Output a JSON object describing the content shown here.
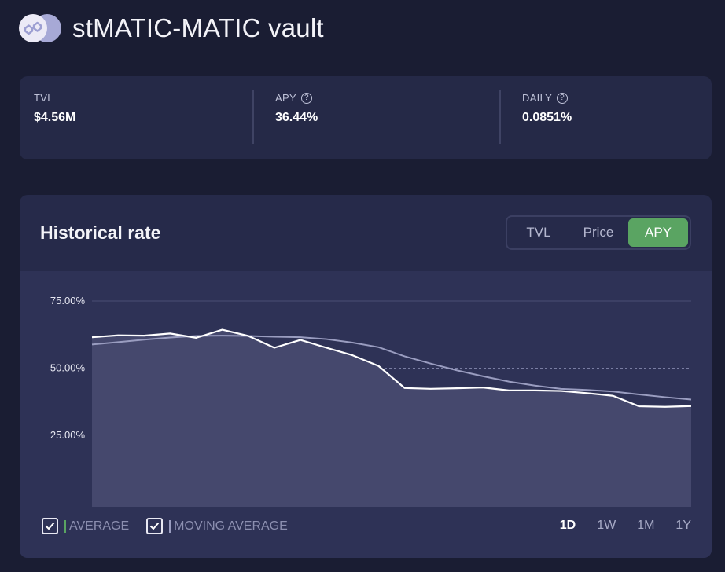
{
  "header": {
    "logo_icon": "polygon-logo-icon",
    "title": "stMATIC-MATIC vault"
  },
  "stats": {
    "tvl": {
      "label": "TVL",
      "value": "$4.56M"
    },
    "apy": {
      "label": "APY",
      "value": "36.44%",
      "help_icon": "question-circle-icon"
    },
    "daily": {
      "label": "DAILY",
      "value": "0.0851%",
      "help_icon": "question-circle-icon"
    }
  },
  "historical": {
    "title": "Historical rate",
    "tabs": [
      {
        "label": "TVL",
        "active": false
      },
      {
        "label": "Price",
        "active": false
      },
      {
        "label": "APY",
        "active": true
      }
    ],
    "legend": {
      "average": "AVERAGE",
      "average_color": "#5aa462",
      "moving_average": "MOVING AVERAGE",
      "moving_average_color": "#9a9dc0"
    },
    "ranges": [
      {
        "label": "1D",
        "active": true
      },
      {
        "label": "1W",
        "active": false
      },
      {
        "label": "1M",
        "active": false
      },
      {
        "label": "1Y",
        "active": false
      }
    ]
  },
  "colors": {
    "accent": "#5aa462",
    "background": "#1a1d33",
    "card": "#262a4a"
  },
  "chart_data": {
    "type": "line",
    "yticks": [
      "75.00%",
      "50.00%",
      "25.00%"
    ],
    "ylim": [
      0,
      75
    ],
    "grid": true,
    "reference_line": 50,
    "series": [
      {
        "name": "APY",
        "values": [
          61.5,
          62.2,
          62.1,
          62.9,
          61.3,
          64.3,
          62.0,
          57.6,
          60.5,
          57.6,
          54.8,
          50.8,
          42.6,
          42.3,
          42.5,
          42.8,
          41.7,
          41.7,
          41.5,
          40.7,
          39.7,
          35.8,
          35.6,
          35.9
        ]
      },
      {
        "name": "MOVING AVERAGE",
        "values": [
          58.8,
          59.7,
          60.6,
          61.4,
          62.0,
          62.1,
          62.0,
          61.7,
          61.5,
          60.8,
          59.5,
          57.8,
          54.4,
          51.7,
          49.2,
          47.0,
          45.0,
          43.5,
          42.3,
          41.9,
          41.3,
          40.2,
          39.2,
          38.3
        ]
      }
    ]
  }
}
